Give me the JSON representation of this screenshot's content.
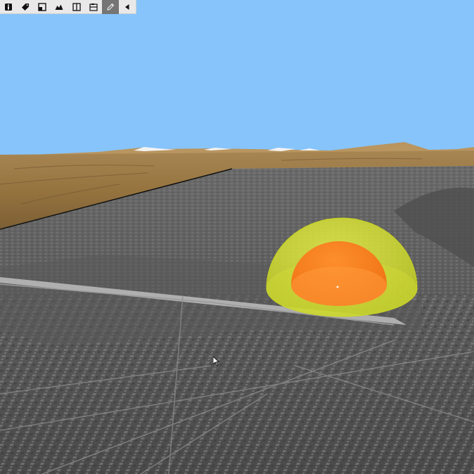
{
  "toolbar": {
    "tools": [
      {
        "id": "info",
        "icon": "info-icon",
        "active": false
      },
      {
        "id": "tag",
        "icon": "tag-icon",
        "active": false
      },
      {
        "id": "window",
        "icon": "window-icon",
        "active": false
      },
      {
        "id": "terrain",
        "icon": "terrain-icon",
        "active": false
      },
      {
        "id": "split",
        "icon": "split-view-icon",
        "active": false
      },
      {
        "id": "panel",
        "icon": "panel-icon",
        "active": false
      },
      {
        "id": "measure",
        "icon": "pencil-icon",
        "active": true
      },
      {
        "id": "collapse",
        "icon": "triangle-left-icon",
        "active": false
      }
    ]
  },
  "scene": {
    "sky_color": "#87c4fb",
    "terrain_color": "#9c7a47",
    "city_color": "#6f6f6f",
    "outer_dome_color": "#d4e22a",
    "inner_dome_color": "#ff7a1f"
  }
}
